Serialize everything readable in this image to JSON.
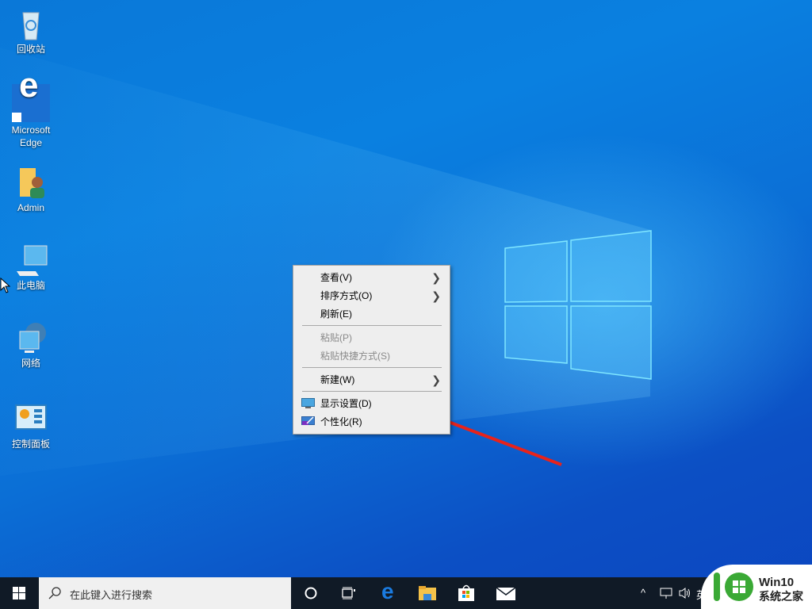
{
  "desktop": {
    "icons": [
      {
        "label": "回收站",
        "icon": "recycle-bin-icon"
      },
      {
        "label": "Microsoft Edge",
        "label_line1": "Microsoft",
        "label_line2": "Edge",
        "icon": "edge-icon"
      },
      {
        "label": "Admin",
        "icon": "user-folder-icon"
      },
      {
        "label": "此电脑",
        "icon": "this-pc-icon"
      },
      {
        "label": "网络",
        "icon": "network-icon"
      },
      {
        "label": "控制面板",
        "icon": "control-panel-icon"
      }
    ]
  },
  "context_menu": {
    "items": [
      {
        "label": "查看(V)",
        "submenu": true,
        "enabled": true
      },
      {
        "label": "排序方式(O)",
        "submenu": true,
        "enabled": true
      },
      {
        "label": "刷新(E)",
        "submenu": false,
        "enabled": true
      },
      {
        "label": "粘贴(P)",
        "submenu": false,
        "enabled": false
      },
      {
        "label": "粘贴快捷方式(S)",
        "submenu": false,
        "enabled": false
      },
      {
        "label": "新建(W)",
        "submenu": true,
        "enabled": true
      },
      {
        "label": "显示设置(D)",
        "submenu": false,
        "enabled": true,
        "icon": "display-icon"
      },
      {
        "label": "个性化(R)",
        "submenu": false,
        "enabled": true,
        "icon": "personalize-icon"
      }
    ],
    "submenu_glyph": ">"
  },
  "annotation": {
    "type": "red-arrow",
    "points_to": "显示设置(D)",
    "color": "#e8231b"
  },
  "taskbar": {
    "search_placeholder": "在此键入进行搜索",
    "pinned": [
      "cortana",
      "task-view",
      "edge",
      "file-explorer",
      "store",
      "mail"
    ],
    "tray": {
      "chevron": "^",
      "ime": "英"
    }
  },
  "watermark": {
    "line1": "Win10",
    "line2": "系统之家",
    "color": "#3aa935"
  },
  "colors": {
    "taskbar": "#101a26",
    "menu_bg": "#eeeeee",
    "accent": "#0a78d8"
  }
}
